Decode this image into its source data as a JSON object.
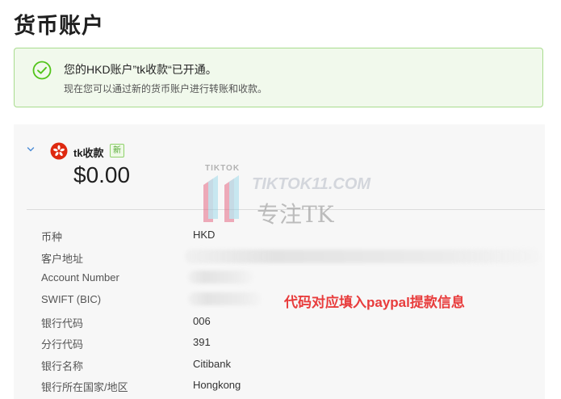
{
  "page": {
    "title": "货币账户"
  },
  "banner": {
    "title": "您的HKD账户”tk收款“已开通。",
    "subtitle": "现在您可以通过新的货币账户进行转账和收款。",
    "icon": "check-circle-icon",
    "color": "#52c41a"
  },
  "account": {
    "name": "tk收款",
    "badge": "新",
    "balance": "$0.00",
    "flag_icon": "hong-kong-flag-icon",
    "details": [
      {
        "label": "币种",
        "value": "HKD",
        "redacted": false
      },
      {
        "label": "客户地址",
        "value": "",
        "redacted": true
      },
      {
        "label": "Account Number",
        "value": "",
        "redacted": true
      },
      {
        "label": "SWIFT (BIC)",
        "value": "",
        "redacted": true
      },
      {
        "label": "银行代码",
        "value": "006",
        "redacted": false
      },
      {
        "label": "分行代码",
        "value": "391",
        "redacted": false
      },
      {
        "label": "银行名称",
        "value": "Citibank",
        "redacted": false
      },
      {
        "label": "银行所在国家/地区",
        "value": "Hongkong",
        "redacted": false
      }
    ]
  },
  "annotation": {
    "text": "代码对应填入paypal提款信息",
    "color": "#e83c3c"
  },
  "watermark": {
    "small": "TIKTOK",
    "site": "TIKTOK11.COM",
    "slogan": "专注TK"
  }
}
